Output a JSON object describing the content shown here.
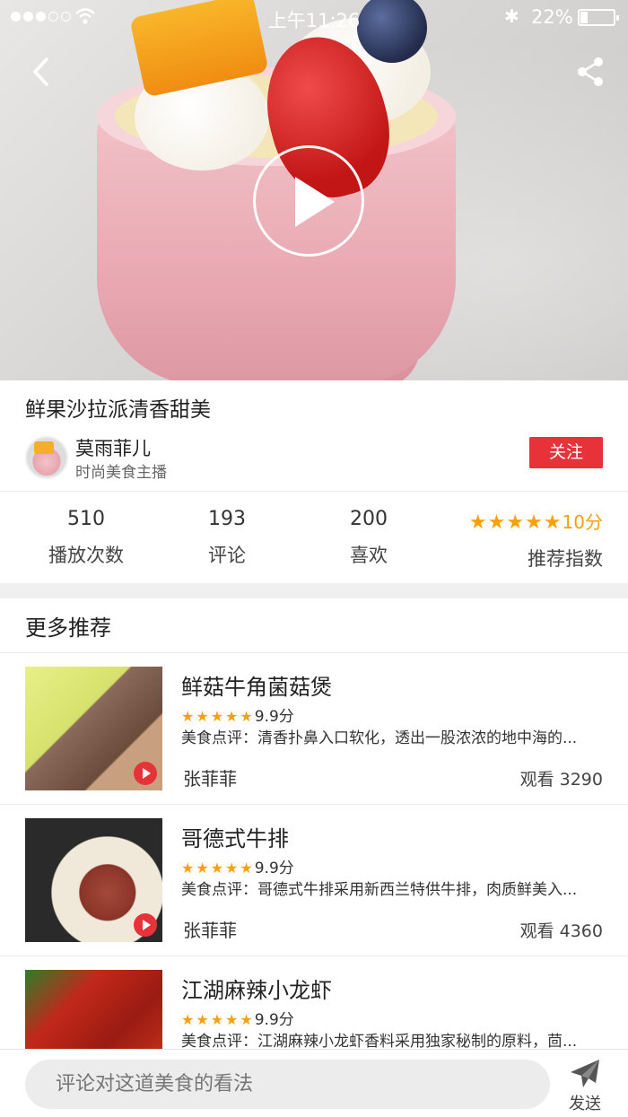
{
  "status_bar": {
    "time": "上午11:26",
    "battery": "22%"
  },
  "video": {
    "title": "鲜果沙拉派清香甜美"
  },
  "author": {
    "name": "莫雨菲儿",
    "role": "时尚美食主播",
    "follow_label": "关注"
  },
  "stats": [
    {
      "value": "510",
      "label": "播放次数"
    },
    {
      "value": "193",
      "label": "评论"
    },
    {
      "value": "200",
      "label": "喜欢"
    }
  ],
  "recommend_index": {
    "stars": 5,
    "score": "10分",
    "label": "推荐指数"
  },
  "more_section": {
    "title": "更多推荐"
  },
  "recommendations": [
    {
      "name": "鲜菇牛角菌菇煲",
      "stars": 5,
      "rating": "9.9分",
      "desc": "美食点评：清香扑鼻入口软化，透出一股浓浓的地中海的...",
      "author": "张菲菲",
      "views": "观看 3290"
    },
    {
      "name": "哥德式牛排",
      "stars": 5,
      "rating": "9.9分",
      "desc": "美食点评：哥德式牛排采用新西兰特供牛排，肉质鲜美入...",
      "author": "张菲菲",
      "views": "观看 4360"
    },
    {
      "name": "江湖麻辣小龙虾",
      "stars": 5,
      "rating": "9.9分",
      "desc": "美食点评：江湖麻辣小龙虾香料采用独家秘制的原料，茴...",
      "author": "",
      "views": ""
    }
  ],
  "comment": {
    "placeholder": "评论对这道美食的看法",
    "send_label": "发送"
  },
  "colors": {
    "accent": "#e8323a",
    "star": "#f7a10a"
  }
}
